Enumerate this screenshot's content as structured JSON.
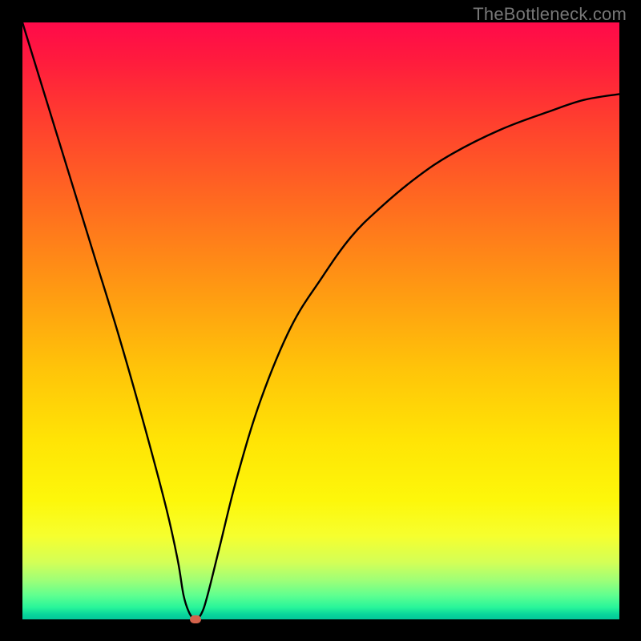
{
  "watermark": "TheBottleneck.com",
  "chart_data": {
    "type": "line",
    "title": "",
    "xlabel": "",
    "ylabel": "",
    "xlim": [
      0,
      100
    ],
    "ylim": [
      0,
      100
    ],
    "grid": false,
    "series": [
      {
        "name": "curve",
        "x": [
          0,
          4,
          8,
          12,
          16,
          20,
          24,
          26,
          27,
          28,
          29,
          30,
          31,
          33,
          36,
          40,
          45,
          50,
          55,
          60,
          66,
          72,
          80,
          88,
          94,
          100
        ],
        "values": [
          100,
          87,
          74,
          61,
          48,
          34,
          19,
          10,
          4,
          1,
          0,
          1,
          4,
          12,
          24,
          37,
          49,
          57,
          64,
          69,
          74,
          78,
          82,
          85,
          87,
          88
        ]
      }
    ],
    "marker": {
      "x": 29,
      "y": 0,
      "color": "#d4634c"
    },
    "gradient_stops": [
      {
        "pos": 0.0,
        "color": "#ff0a4a"
      },
      {
        "pos": 0.16,
        "color": "#ff3d2f"
      },
      {
        "pos": 0.45,
        "color": "#ff9a12"
      },
      {
        "pos": 0.7,
        "color": "#ffe405"
      },
      {
        "pos": 0.86,
        "color": "#f6ff2e"
      },
      {
        "pos": 0.96,
        "color": "#5fff90"
      },
      {
        "pos": 1.0,
        "color": "#04c799"
      }
    ]
  }
}
